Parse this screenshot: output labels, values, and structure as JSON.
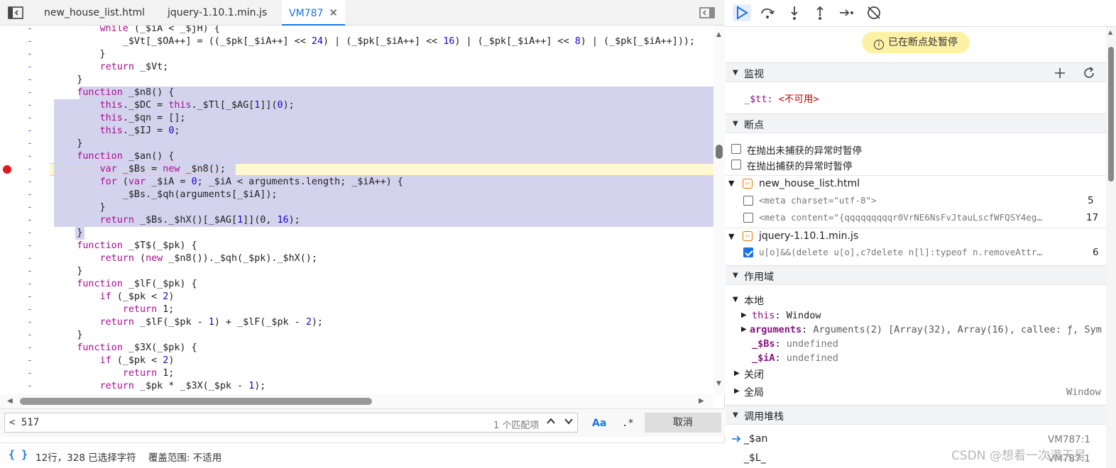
{
  "tabs": [
    {
      "label": "new_house_list.html",
      "active": false
    },
    {
      "label": "jquery-1.10.1.min.js",
      "active": false
    },
    {
      "label": "VM787",
      "active": true
    }
  ],
  "code_lines": [
    {
      "gutter": "-",
      "text": "    while (_$iA < _$jH) {"
    },
    {
      "gutter": "-",
      "text": "        _$Vt[_$OA++] = ((_$pk[_$iA++] << 24) | (_$pk[_$iA++] << 16) | (_$pk[_$iA++] << 8) | (_$pk[_$iA++]));"
    },
    {
      "gutter": "-",
      "text": "    }"
    },
    {
      "gutter": "-",
      "text": "    return _$Vt;"
    },
    {
      "gutter": "-",
      "text": "}"
    },
    {
      "gutter": "-",
      "text": "function _$n8() {"
    },
    {
      "gutter": "-",
      "text": "    this._$DC = this._$Tl[_$AG[1]](0);"
    },
    {
      "gutter": "-",
      "text": "    this._$qn = [];"
    },
    {
      "gutter": "-",
      "text": "    this._$IJ = 0;"
    },
    {
      "gutter": "-",
      "text": "}"
    },
    {
      "gutter": "-",
      "text": "function _$an() {"
    },
    {
      "gutter": "-",
      "text": "    var _$Bs = new _$n8();"
    },
    {
      "gutter": "-",
      "text": "    for (var _$iA = 0; _$iA < arguments.length; _$iA++) {"
    },
    {
      "gutter": "-",
      "text": "        _$Bs._$qh(arguments[_$iA]);"
    },
    {
      "gutter": "-",
      "text": "    }"
    },
    {
      "gutter": "-",
      "text": "    return _$Bs._$hX()[_$AG[1]](0, 16);"
    },
    {
      "gutter": "-",
      "text": "}"
    },
    {
      "gutter": "-",
      "text": "function _$T$(_$pk) {"
    },
    {
      "gutter": "-",
      "text": "    return (new _$n8())._$qh(_$pk)._$hX();"
    },
    {
      "gutter": "-",
      "text": "}"
    },
    {
      "gutter": "-",
      "text": "function _$lF(_$pk) {"
    },
    {
      "gutter": "-",
      "text": "    if (_$pk < 2)"
    },
    {
      "gutter": "-",
      "text": "        return 1;"
    },
    {
      "gutter": "-",
      "text": "    return _$lF(_$pk - 1) + _$lF(_$pk - 2);"
    },
    {
      "gutter": "-",
      "text": "}"
    },
    {
      "gutter": "-",
      "text": "function _$3X(_$pk) {"
    },
    {
      "gutter": "-",
      "text": "    if (_$pk < 2)"
    },
    {
      "gutter": "-",
      "text": "        return 1;"
    },
    {
      "gutter": "-",
      "text": "    return _$pk * _$3X(_$pk - 1);"
    }
  ],
  "search": {
    "value": "< 517",
    "match_count": "1 个匹配项",
    "case_label": "Aa",
    "regex_label": ".*",
    "cancel_label": "取消"
  },
  "status": {
    "braces": "{ }",
    "text": "12行，328 已选择字符    覆盖范围: 不适用"
  },
  "debugger": {
    "paused_label": "已在断点处暂停",
    "watch": {
      "title": "监视",
      "items": [
        {
          "name": "_$tt",
          "value": "<不可用>"
        }
      ]
    },
    "breakpoints": {
      "title": "断点",
      "options": [
        {
          "label": "在抛出未捕获的异常时暂停",
          "checked": false
        },
        {
          "label": "在抛出捕获的异常时暂停",
          "checked": false
        }
      ],
      "files": [
        {
          "name": "new_house_list.html",
          "items": [
            {
              "code": "<meta charset=\"utf-8\">",
              "line": "5",
              "checked": false
            },
            {
              "code": "<meta content=\"{qqqqqqqqqr0VrNE6NsFvJtauLscfWFQSY4eg…",
              "line": "17",
              "checked": false
            }
          ]
        },
        {
          "name": "jquery-1.10.1.min.js",
          "items": [
            {
              "code": "u[o]&&(delete u[o],c?delete n[l]:typeof n.removeAttr…",
              "line": "6",
              "checked": true
            }
          ]
        }
      ]
    },
    "scope": {
      "title": "作用域",
      "local_label": "本地",
      "local": [
        {
          "name": "this",
          "value": "Window"
        },
        {
          "name": "arguments",
          "value": "Arguments(2) [Array(32), Array(16), callee: ƒ, Sym"
        },
        {
          "name": "_$Bs",
          "value": "undefined"
        },
        {
          "name": "_$iA",
          "value": "undefined"
        }
      ],
      "closure_label": "关闭",
      "global_label": "全局",
      "global_value": "Window"
    },
    "callstack": {
      "title": "调用堆栈",
      "frames": [
        {
          "name": "_$an",
          "location": "VM787:1"
        },
        {
          "name": "_$L_",
          "location": "VM787:1"
        }
      ]
    }
  },
  "watermark": "CSDN @想看一次满天星",
  "colors": {
    "accent": "#1a73e8",
    "selection": "#d4d3ee",
    "paused_bg": "#fdf1a5",
    "breakpoint": "#e0191f"
  }
}
